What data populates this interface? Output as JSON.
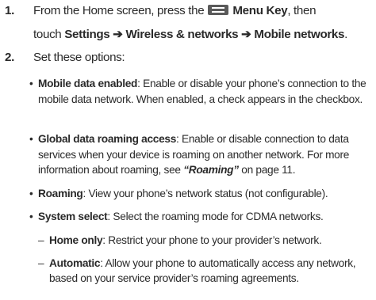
{
  "steps": [
    {
      "number": "1.",
      "line1_pre": "From the Home screen, press the",
      "menu_icon": "menu-key-icon",
      "menu_key": "Menu Key",
      "line1_post": ", then",
      "line2_pre": "touch ",
      "path": "Settings ➔ Wireless & networks ➔ Mobile networks",
      "line2_post": "."
    },
    {
      "number": "2.",
      "text": "Set these options:"
    }
  ],
  "options": [
    {
      "term": "Mobile data enabled",
      "desc": ": Enable or disable your phone’s connection to the mobile data network. When enabled, a check appears in the checkbox."
    },
    {
      "term": "Global data roaming access",
      "desc_pre": ": Enable or disable connection to data services when your device is roaming on another network. For more information about roaming, see ",
      "ref": "“Roaming”",
      "desc_post": " on page 11."
    },
    {
      "term": "Roaming",
      "desc": ": View your phone’s network status (not configurable)."
    },
    {
      "term": "System select",
      "desc": ": Select the roaming mode for CDMA networks."
    }
  ],
  "sub_options": [
    {
      "term": "Home only",
      "desc": ": Restrict your phone to your provider’s network."
    },
    {
      "term": "Automatic",
      "desc": ": Allow your phone to automatically access any network, based on your service provider’s roaming agreements."
    }
  ],
  "glyphs": {
    "bullet": "•",
    "dash": "–"
  }
}
